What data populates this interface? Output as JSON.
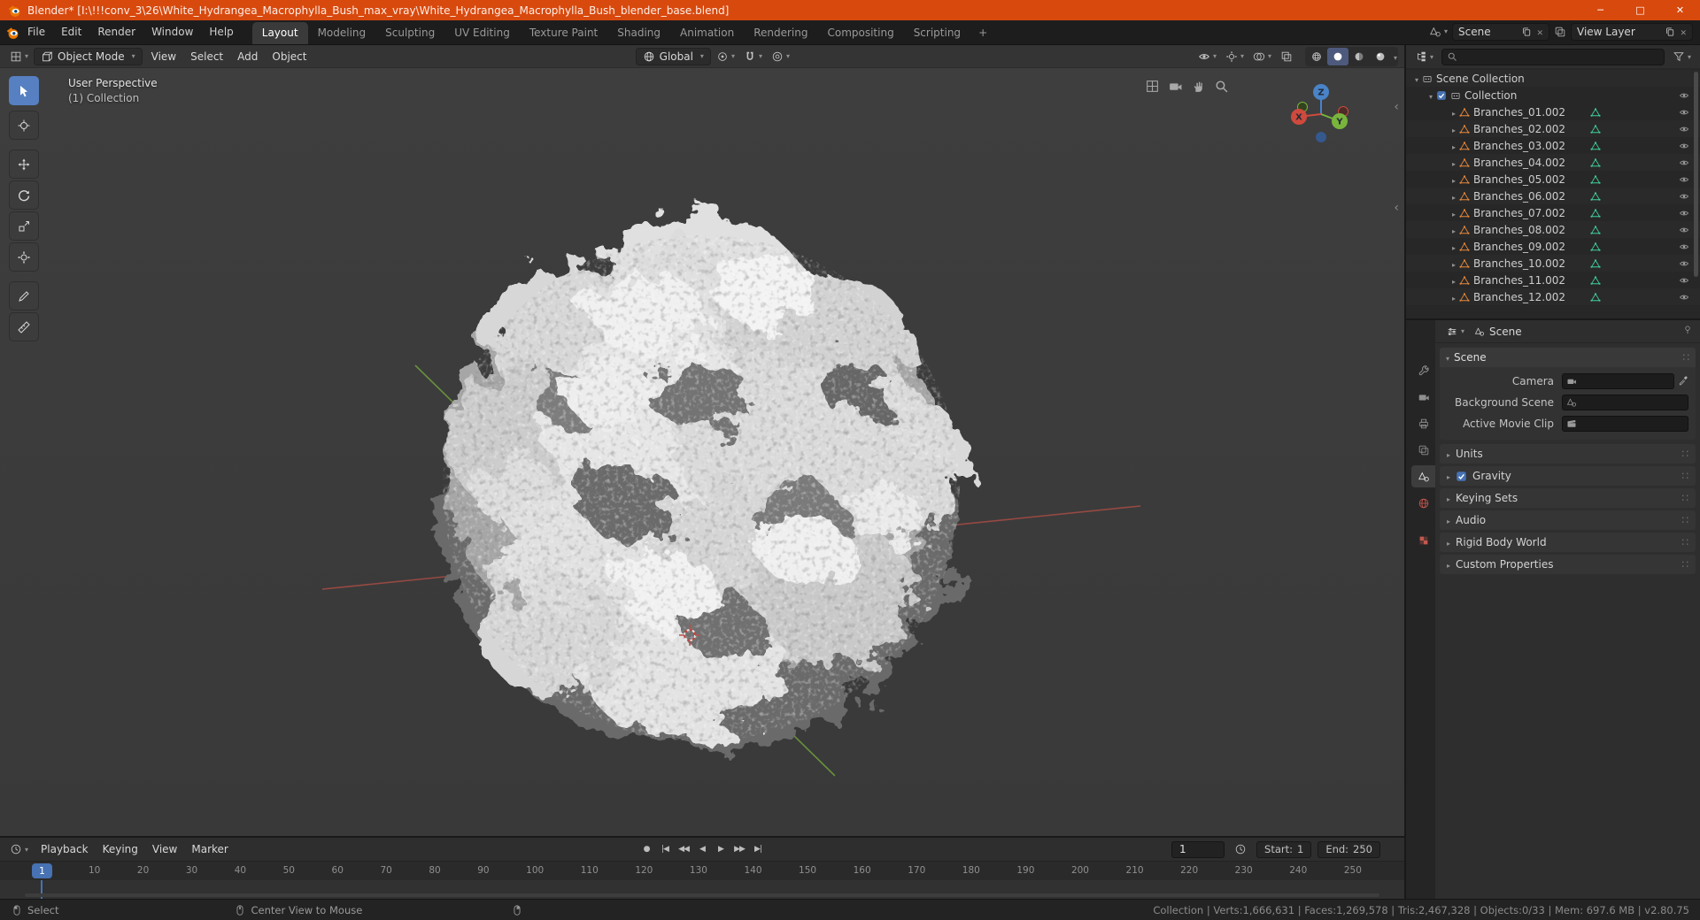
{
  "window": {
    "title": "Blender* [I:\\!!!conv_3\\26\\White_Hydrangea_Macrophylla_Bush_max_vray\\White_Hydrangea_Macrophylla_Bush_blender_base.blend]"
  },
  "topbar": {
    "menus": [
      "File",
      "Edit",
      "Render",
      "Window",
      "Help"
    ],
    "workspaces": [
      {
        "label": "Layout",
        "active": true
      },
      {
        "label": "Modeling"
      },
      {
        "label": "Sculpting"
      },
      {
        "label": "UV Editing"
      },
      {
        "label": "Texture Paint"
      },
      {
        "label": "Shading"
      },
      {
        "label": "Animation"
      },
      {
        "label": "Rendering"
      },
      {
        "label": "Compositing"
      },
      {
        "label": "Scripting"
      }
    ],
    "new_workspace": "+",
    "scene_label": "Scene",
    "view_layer_label": "View Layer"
  },
  "viewport": {
    "header": {
      "mode": "Object Mode",
      "menus": [
        "View",
        "Select",
        "Add",
        "Object"
      ],
      "orientation": "Global"
    },
    "overlay": {
      "line1": "User Perspective",
      "line2": "(1) Collection"
    },
    "axes": {
      "x": "X",
      "y": "Y",
      "z": "Z"
    }
  },
  "toolbar_tools": [
    "select-box",
    "cursor",
    "move",
    "rotate",
    "scale",
    "transform",
    "annotate",
    "measure"
  ],
  "outliner": {
    "scene_collection": "Scene Collection",
    "collection": "Collection",
    "items": [
      "Branches_01.002",
      "Branches_02.002",
      "Branches_03.002",
      "Branches_04.002",
      "Branches_05.002",
      "Branches_06.002",
      "Branches_07.002",
      "Branches_08.002",
      "Branches_09.002",
      "Branches_10.002",
      "Branches_11.002",
      "Branches_12.002"
    ]
  },
  "properties": {
    "breadcrumb": "Scene",
    "section_title": "Scene",
    "fields": [
      {
        "label": "Camera"
      },
      {
        "label": "Background Scene"
      },
      {
        "label": "Active Movie Clip"
      }
    ],
    "sections": [
      {
        "label": "Units"
      },
      {
        "label": "Gravity",
        "checkbox": true
      },
      {
        "label": "Keying Sets"
      },
      {
        "label": "Audio"
      },
      {
        "label": "Rigid Body World"
      },
      {
        "label": "Custom Properties"
      }
    ]
  },
  "timeline": {
    "menus": [
      "Playback",
      "Keying",
      "View",
      "Marker"
    ],
    "playback": [
      {
        "name": "auto-keying",
        "glyph": "●"
      },
      {
        "name": "jump-to-start",
        "glyph": "|◀"
      },
      {
        "name": "previous-keyframe",
        "glyph": "◀◀"
      },
      {
        "name": "play-reverse",
        "glyph": "◀"
      },
      {
        "name": "play",
        "glyph": "▶"
      },
      {
        "name": "next-keyframe",
        "glyph": "▶▶"
      },
      {
        "name": "jump-to-end",
        "glyph": "▶|"
      }
    ],
    "current_frame": "1",
    "playhead": "1",
    "start_label": "Start:",
    "start_value": "1",
    "end_label": "End:",
    "end_value": "250",
    "ticks": [
      "10",
      "20",
      "30",
      "40",
      "50",
      "60",
      "70",
      "80",
      "90",
      "100",
      "110",
      "120",
      "130",
      "140",
      "150",
      "160",
      "170",
      "180",
      "190",
      "200",
      "210",
      "220",
      "230",
      "240",
      "250"
    ]
  },
  "statusbar": {
    "select_hint": "Select",
    "middle_hint": "Center View to Mouse",
    "stats": "Collection | Verts:1,666,631 | Faces:1,269,578 | Tris:2,467,328 | Objects:0/33 | Mem: 697.6 MB | v2.80.75"
  },
  "colors": {
    "titlebar": "#d8490e",
    "accent_blue": "#4772b3",
    "active_tool": "#5680c2",
    "mesh_icon": "#e8883a",
    "mesh_data_icon": "#3fcf9b"
  }
}
